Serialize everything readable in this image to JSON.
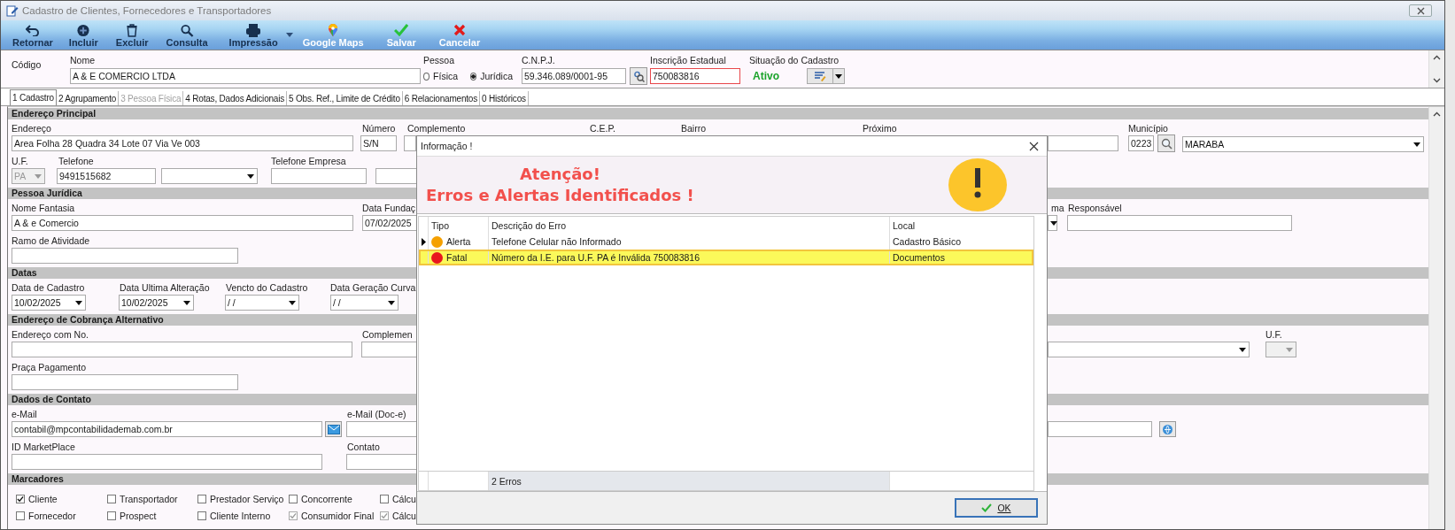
{
  "window": {
    "title": "Cadastro de Clientes, Fornecedores e Transportadores"
  },
  "toolbar": [
    {
      "label": "Retornar",
      "disabled": true,
      "has_menu": false
    },
    {
      "label": "Incluir",
      "disabled": true,
      "has_menu": false
    },
    {
      "label": "Excluir",
      "disabled": true,
      "has_menu": false
    },
    {
      "label": "Consulta",
      "disabled": true,
      "has_menu": false
    },
    {
      "label": "Impressão",
      "disabled": true,
      "has_menu": true
    },
    {
      "label": "Google Maps",
      "disabled": false,
      "has_menu": false
    },
    {
      "label": "Salvar",
      "disabled": false,
      "has_menu": false
    },
    {
      "label": "Cancelar",
      "disabled": false,
      "has_menu": false
    }
  ],
  "header": {
    "codigo_label": "Código",
    "nome_label": "Nome",
    "nome": "A & E COMERCIO LTDA",
    "pessoa_label": "Pessoa",
    "pessoa_options": [
      {
        "label": "Física",
        "selected": false
      },
      {
        "label": "Jurídica",
        "selected": true
      }
    ],
    "cnpj_label": "C.N.P.J.",
    "cnpj": "59.346.089/0001-95",
    "ie_label": "Inscrição Estadual",
    "ie": "750083816",
    "ie_invalid": true,
    "situacao_label": "Situação do Cadastro",
    "situacao": "Ativo"
  },
  "tabs": [
    {
      "label": "1 Cadastro",
      "selected": true,
      "disabled": false
    },
    {
      "label": "2 Agrupamento",
      "selected": false,
      "disabled": false
    },
    {
      "label": "3 Pessoa Física",
      "selected": false,
      "disabled": true
    },
    {
      "label": "4 Rotas, Dados Adicionais",
      "selected": false,
      "disabled": false
    },
    {
      "label": "5 Obs. Ref., Limite de Crédito",
      "selected": false,
      "disabled": false
    },
    {
      "label": "6 Relacionamentos",
      "selected": false,
      "disabled": false
    },
    {
      "label": "0 Históricos",
      "selected": false,
      "disabled": false
    }
  ],
  "sections": [
    {
      "title": "Endereço Principal",
      "rows": [
        [
          {
            "kind": "field",
            "label": "Endereço",
            "value": "Area Folha 28 Quadra 34 Lote 07 Via Ve 003"
          },
          {
            "kind": "field",
            "label": "Número",
            "value": "S/N"
          },
          {
            "kind": "field",
            "label": "Complemento"
          },
          {
            "kind": "caption",
            "label": "C.E.P."
          },
          {
            "kind": "caption",
            "label": "Bairro"
          },
          {
            "kind": "field",
            "label": "Próximo"
          },
          {
            "kind": "field",
            "label": "Município",
            "value": "0223"
          },
          {
            "kind": "lookup"
          },
          {
            "kind": "combo",
            "value": "MARABA",
            "disabled": false
          }
        ],
        [
          {
            "kind": "label",
            "text": "U.F."
          },
          {
            "kind": "label",
            "text": "Telefone"
          },
          {
            "kind": "label",
            "text": "Telefone Empresa"
          }
        ],
        [
          {
            "kind": "combo",
            "value": "PA",
            "disabled": true
          },
          {
            "kind": "field",
            "value": "9491515682"
          },
          {
            "kind": "combo",
            "disabled": false
          },
          {
            "kind": "field"
          },
          {
            "kind": "field"
          }
        ]
      ]
    },
    {
      "title": "Pessoa Jurídica",
      "rows": [
        [
          {
            "kind": "label",
            "text": "Nome Fantasia"
          },
          {
            "kind": "label",
            "text": "Data Fundaç"
          },
          {
            "kind": "label",
            "text": "ma"
          },
          {
            "kind": "label",
            "text": "Responsável"
          }
        ],
        [
          {
            "kind": "field",
            "value": "A & e Comercio"
          },
          {
            "kind": "field",
            "value": "07/02/2025"
          },
          {
            "kind": "combo",
            "disabled": false
          },
          {
            "kind": "field"
          }
        ],
        [
          {
            "kind": "label",
            "text": "Ramo de Atividade"
          }
        ],
        [
          {
            "kind": "field"
          }
        ]
      ]
    },
    {
      "title": "Datas",
      "rows": [
        [
          {
            "kind": "label",
            "text": "Data de Cadastro"
          },
          {
            "kind": "label",
            "text": "Data Ultima Alteração"
          },
          {
            "kind": "label",
            "text": "Vencto do Cadastro"
          },
          {
            "kind": "label",
            "text": "Data Geração Curva"
          }
        ],
        [
          {
            "kind": "combo",
            "value": "10/02/2025",
            "disabled": false
          },
          {
            "kind": "combo",
            "value": "10/02/2025",
            "disabled": false
          },
          {
            "kind": "combo",
            "value": "/ /",
            "disabled": false
          },
          {
            "kind": "combo",
            "value": "/ /",
            "disabled": false
          }
        ]
      ]
    },
    {
      "title": "Endereço de Cobrança Alternativo",
      "rows": [
        [
          {
            "kind": "label",
            "text": "Endereço com No."
          },
          {
            "kind": "label",
            "text": "Complemen"
          },
          {
            "kind": "label",
            "text": "U.F."
          }
        ],
        [
          {
            "kind": "field"
          },
          {
            "kind": "field"
          },
          {
            "kind": "combo",
            "disabled": false
          },
          {
            "kind": "combo",
            "disabled": true
          }
        ],
        [
          {
            "kind": "label",
            "text": "Praça Pagamento"
          }
        ],
        [
          {
            "kind": "field"
          }
        ]
      ]
    },
    {
      "title": "Dados de Contato",
      "rows": [
        [
          {
            "kind": "label",
            "text": "e-Mail"
          },
          {
            "kind": "label",
            "text": "e-Mail (Doc-e)"
          }
        ],
        [
          {
            "kind": "field",
            "value": "contabil@mpcontabilidademab.com.br"
          },
          {
            "kind": "mailer"
          },
          {
            "kind": "field"
          },
          {
            "kind": "field"
          },
          {
            "kind": "browser"
          }
        ],
        [
          {
            "kind": "label",
            "text": "ID MarketPlace"
          },
          {
            "kind": "label",
            "text": "Contato"
          }
        ],
        [
          {
            "kind": "field"
          },
          {
            "kind": "field"
          }
        ]
      ]
    },
    {
      "title": "Marcadores",
      "rows": [
        [
          {
            "kind": "checkbox",
            "label": "Cliente",
            "checked": true,
            "disabled": false
          },
          {
            "kind": "checkbox",
            "label": "Transportador",
            "checked": false,
            "disabled": false
          },
          {
            "kind": "checkbox",
            "label": "Prestador Serviço",
            "checked": false,
            "disabled": false
          },
          {
            "kind": "checkbox",
            "label": "Concorrente",
            "checked": false,
            "disabled": false
          },
          {
            "kind": "checkbox",
            "label": "Cálcu",
            "checked": false,
            "disabled": false
          }
        ],
        [
          {
            "kind": "checkbox",
            "label": "Fornecedor",
            "checked": false,
            "disabled": false
          },
          {
            "kind": "checkbox",
            "label": "Prospect",
            "checked": false,
            "disabled": false
          },
          {
            "kind": "checkbox",
            "label": "Cliente Interno",
            "checked": false,
            "disabled": false
          },
          {
            "kind": "checkbox",
            "label": "Consumidor Final",
            "checked": true,
            "disabled": true
          },
          {
            "kind": "checkbox",
            "label": "Cálcu",
            "checked": true,
            "disabled": true
          }
        ]
      ]
    }
  ],
  "dialog": {
    "title": "Informação !",
    "heading": "Atenção!",
    "subheading": "Erros e Alertas Identificados !",
    "columns": [
      "Tipo",
      "Descrição do Erro",
      "Local"
    ],
    "rows": [
      {
        "tipo": "Alerta",
        "color": "#f5a000",
        "descricao": "Telefone Celular não Informado",
        "local": "Cadastro Básico",
        "current": true,
        "selected": false
      },
      {
        "tipo": "Fatal",
        "color": "#e8161e",
        "descricao": "Número da I.E. para U.F. PA é Inválida 750083816",
        "local": "Documentos",
        "current": false,
        "selected": true
      }
    ],
    "summary": "2 Erros",
    "ok_button": "OK"
  }
}
